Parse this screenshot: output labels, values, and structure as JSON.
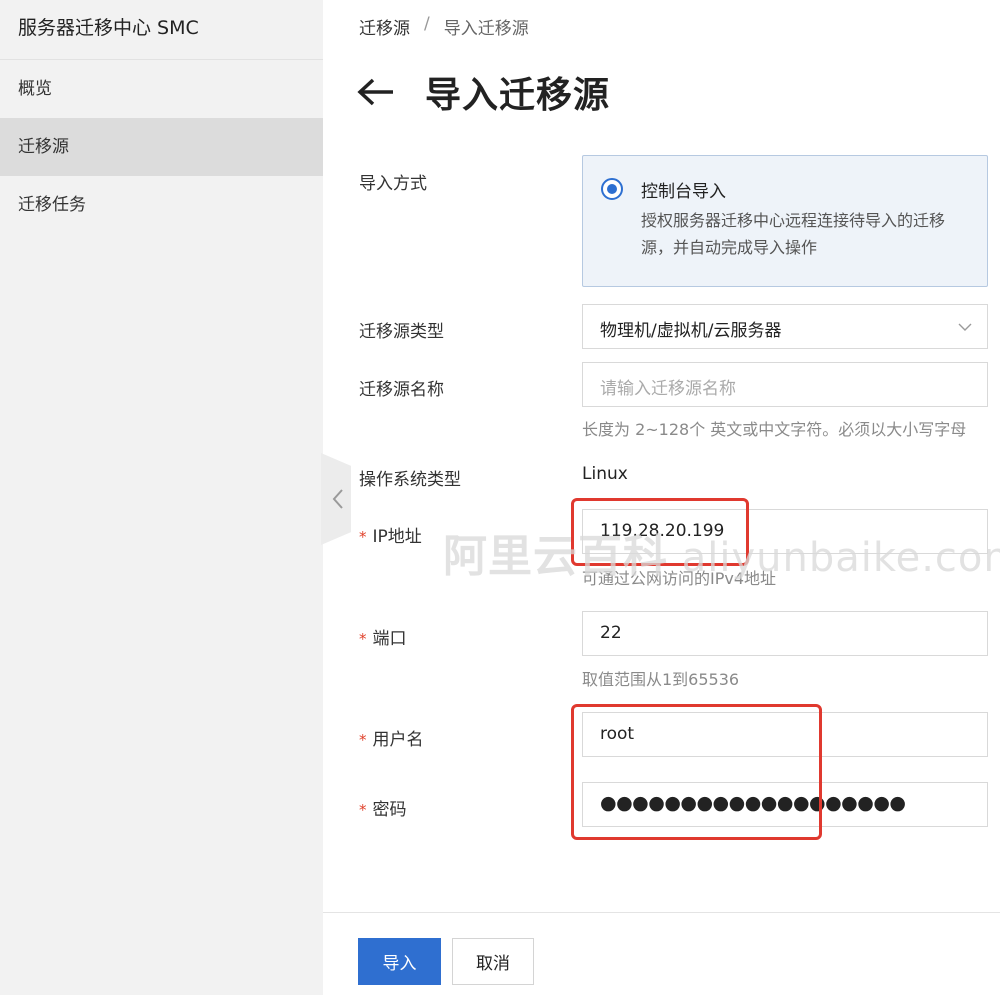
{
  "sidebar": {
    "title": "服务器迁移中心 SMC",
    "items": [
      {
        "label": "概览",
        "active": false
      },
      {
        "label": "迁移源",
        "active": true
      },
      {
        "label": "迁移任务",
        "active": false
      }
    ]
  },
  "breadcrumb": {
    "parent": "迁移源",
    "separator": "/",
    "current": "导入迁移源"
  },
  "page": {
    "title": "导入迁移源"
  },
  "form": {
    "import_method": {
      "label": "导入方式",
      "option_title": "控制台导入",
      "option_desc": "授权服务器迁移中心远程连接待导入的迁移源，并自动完成导入操作",
      "selected": true
    },
    "source_type": {
      "label": "迁移源类型",
      "value": "物理机/虚拟机/云服务器"
    },
    "source_name": {
      "label": "迁移源名称",
      "placeholder": "请输入迁移源名称",
      "hint": "长度为 2~128个 英文或中文字符。必须以大小写字母"
    },
    "os_type": {
      "label": "操作系统类型",
      "value": "Linux"
    },
    "ip": {
      "required_mark": "*",
      "label": "IP地址",
      "value": "119.28.20.199",
      "hint": "可通过公网访问的IPv4地址"
    },
    "port": {
      "required_mark": "*",
      "label": "端口",
      "value": "22",
      "hint": "取值范围从1到65536"
    },
    "username": {
      "required_mark": "*",
      "label": "用户名",
      "value": "root"
    },
    "password": {
      "required_mark": "*",
      "label": "密码",
      "masked_value": "●●●●●●●●●●●●●●●●●●●"
    }
  },
  "footer": {
    "submit_label": "导入",
    "cancel_label": "取消"
  },
  "watermark": {
    "cn": "阿里云百科",
    "latin": " aliyunbaike.com"
  },
  "colors": {
    "primary": "#2f6fd0",
    "required": "#e0422c",
    "highlight": "#e0392f",
    "sidebar_bg": "#f2f2f2",
    "radio_card_bg": "#eef3f9"
  }
}
